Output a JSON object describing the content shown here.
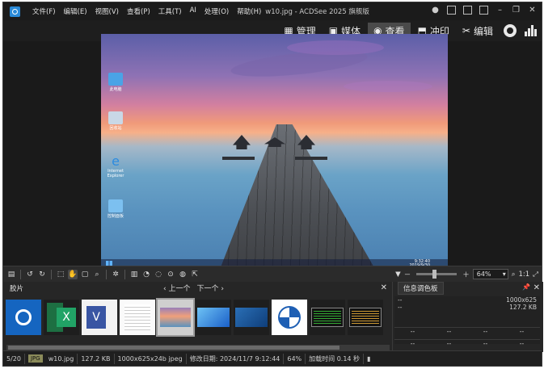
{
  "menu": {
    "items": [
      "文件(F)",
      "编辑(E)",
      "视图(V)",
      "查看(P)",
      "工具(T)",
      "AI",
      "处理(O)",
      "帮助(H)"
    ],
    "title": "w10.jpg - ACDSee 2025 旗舰版"
  },
  "modes": [
    {
      "label": "管理",
      "icon": "grid-icon"
    },
    {
      "label": "媒体",
      "icon": "media-icon"
    },
    {
      "label": "查看",
      "icon": "eye-icon",
      "active": true
    },
    {
      "label": "冲印",
      "icon": "develop-icon"
    },
    {
      "label": "编辑",
      "icon": "edit-icon"
    }
  ],
  "desktop": {
    "icons": [
      "此电脑",
      "回收站",
      "Internet Explorer",
      "控制面板"
    ],
    "clock": "9:32:40",
    "date": "2019/9/30"
  },
  "toolbar": {
    "zoom_value": "64%",
    "zoom_ratio": "1:1"
  },
  "filmstrip": {
    "title": "胶片",
    "prev": "上一个",
    "next": "下一个",
    "selected_index": 4,
    "thumbnails": [
      "acdsee",
      "excel",
      "visio",
      "document",
      "pier",
      "windows11",
      "desktop",
      "network",
      "monitor-a",
      "monitor-b"
    ]
  },
  "info_panel": {
    "tab": "信息调色板",
    "rows": [
      {
        "left": "--",
        "right": "1000x625"
      },
      {
        "left": "--",
        "right": "127.2 KB"
      }
    ],
    "grid": [
      "--",
      "--",
      "--",
      "--",
      "--",
      "--",
      "--",
      "--",
      "--",
      "--",
      "--",
      "--"
    ]
  },
  "status": {
    "position": "5/20",
    "type": "JPG",
    "filename": "w10.jpg",
    "size": "127.2 KB",
    "dims": "1000x625x24b jpeg",
    "modified": "修改日期: 2024/11/7 9:12:44",
    "zoom": "64%",
    "load_time": "加载时间 0.14 秒"
  },
  "colors": {
    "accent": "#2a8ad8",
    "background": "#1e1e1e",
    "panel": "#262626"
  }
}
